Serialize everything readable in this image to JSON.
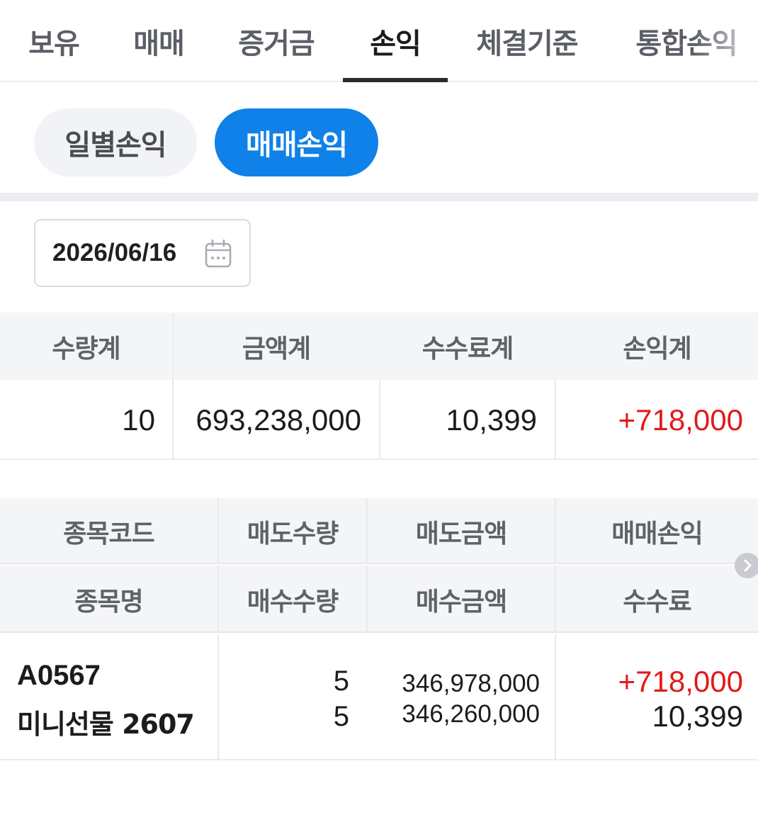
{
  "tabs": [
    {
      "label": "보유"
    },
    {
      "label": "매매"
    },
    {
      "label": "증거금"
    },
    {
      "label": "손익"
    },
    {
      "label": "체결기준"
    },
    {
      "label": "통합손익"
    }
  ],
  "active_tab": "손익",
  "segments": {
    "daily_label": "일별손익",
    "trade_label": "매매손익",
    "active": "매매손익"
  },
  "date_picker": {
    "value": "2026/06/16",
    "icon": "calendar-icon"
  },
  "summary": {
    "headers": [
      "수량계",
      "금액계",
      "수수료계",
      "손익계"
    ],
    "values": [
      "10",
      "693,238,000",
      "10,399",
      "+718,000"
    ]
  },
  "detail": {
    "headers_row1": [
      "종목코드",
      "매도수량",
      "매도금액",
      "매매손익"
    ],
    "headers_row2": [
      "종목명",
      "매수수량",
      "매수금액",
      "수수료"
    ],
    "rows": [
      {
        "code": "A0567",
        "name": "미니선물 2607",
        "sell_qty": "5",
        "buy_qty": "5",
        "sell_amount": "346,978,000",
        "buy_amount": "346,260,000",
        "pnl": "+718,000",
        "fee": "10,399"
      }
    ]
  },
  "colors": {
    "accent": "#1081e8",
    "profit": "#e11a1a",
    "header_bg": "#f4f5f7"
  }
}
